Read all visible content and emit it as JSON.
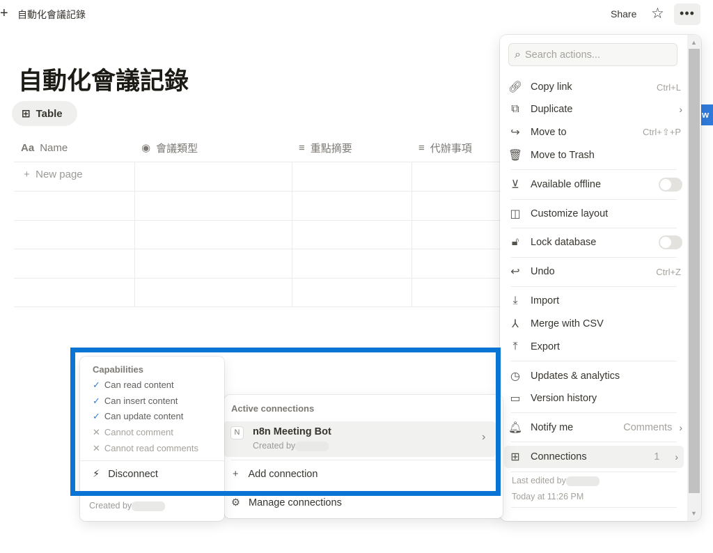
{
  "topbar": {
    "breadcrumb": "自動化會議記錄",
    "share": "Share"
  },
  "page": {
    "title": "自動化會議記錄",
    "view_tab": "Table"
  },
  "table": {
    "columns": [
      {
        "icon": "Aa",
        "label": "Name"
      },
      {
        "icon": "◉",
        "label": "會議類型"
      },
      {
        "icon": "≡",
        "label": "重點摘要"
      },
      {
        "icon": "≡",
        "label": "代辦事項"
      }
    ],
    "new_page": "New page"
  },
  "new_button_fragment": "w",
  "menu": {
    "search_placeholder": "Search actions...",
    "items": [
      {
        "label": "Copy link",
        "shortcut": "Ctrl+L"
      },
      {
        "label": "Duplicate"
      },
      {
        "label": "Move to",
        "shortcut": "Ctrl+⇧+P"
      },
      {
        "label": "Move to Trash"
      },
      {
        "label": "Available offline",
        "toggle": false
      },
      {
        "label": "Customize layout"
      },
      {
        "label": "Lock database",
        "toggle": false
      },
      {
        "label": "Undo",
        "shortcut": "Ctrl+Z"
      },
      {
        "label": "Import"
      },
      {
        "label": "Merge with CSV"
      },
      {
        "label": "Export"
      },
      {
        "label": "Updates & analytics"
      },
      {
        "label": "Version history"
      },
      {
        "label": "Notify me",
        "value": "Comments"
      },
      {
        "label": "Connections",
        "value": "1"
      }
    ],
    "last_edited": "Last edited by",
    "edited_time": "Today at 11:26 PM"
  },
  "connections": {
    "section_label": "Active connections",
    "bot": {
      "initial": "N",
      "name": "n8n Meeting Bot",
      "created_by": "Created by"
    },
    "add": "Add connection",
    "manage": "Manage connections"
  },
  "capabilities": {
    "title": "Capabilities",
    "items": [
      {
        "label": "Can read content",
        "allowed": true
      },
      {
        "label": "Can insert content",
        "allowed": true
      },
      {
        "label": "Can update content",
        "allowed": true
      },
      {
        "label": "Cannot comment",
        "allowed": false
      },
      {
        "label": "Cannot read comments",
        "allowed": false
      }
    ],
    "disconnect": "Disconnect",
    "created_by": "Created by"
  },
  "colors": {
    "highlight": "#0a74d4",
    "check": "#2f7bdc"
  }
}
